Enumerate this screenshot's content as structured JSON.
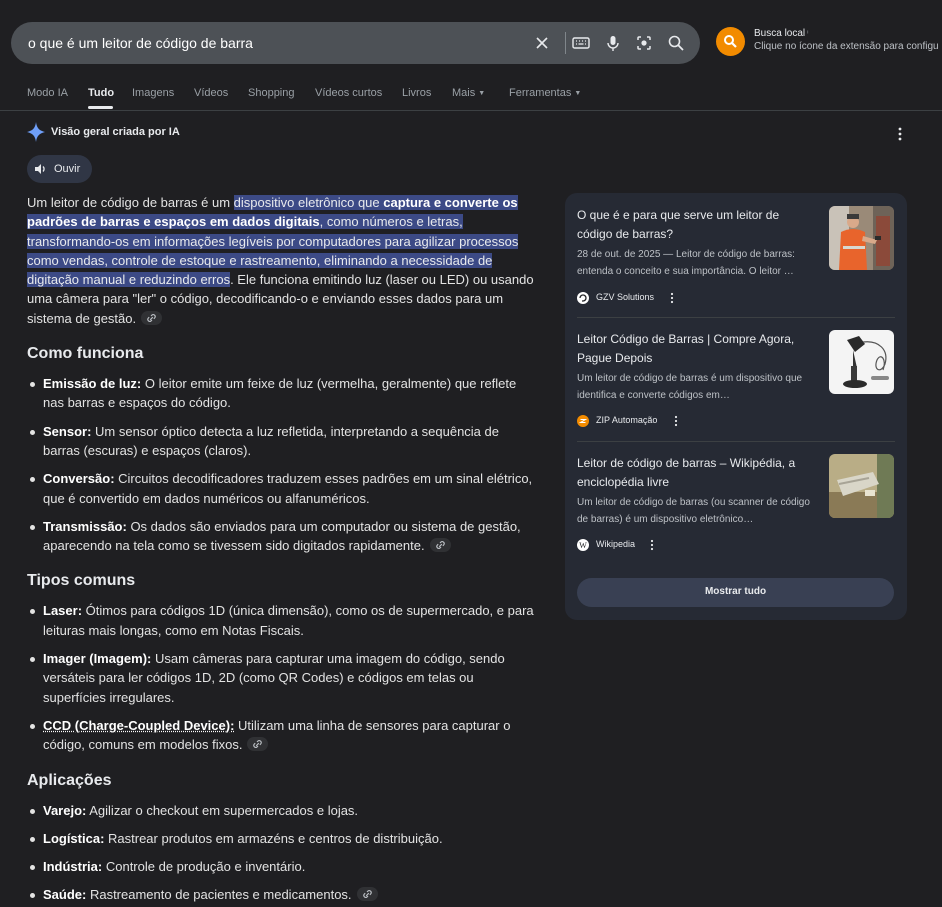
{
  "search": {
    "query": "o que é um leitor de código de barra"
  },
  "extension": {
    "title": "Busca local",
    "info": "ⁱ",
    "subtitle": "Clique no ícone da extensão para configu"
  },
  "tabs": [
    {
      "label": "Modo IA"
    },
    {
      "label": "Tudo"
    },
    {
      "label": "Imagens"
    },
    {
      "label": "Vídeos"
    },
    {
      "label": "Shopping"
    },
    {
      "label": "Vídeos curtos"
    },
    {
      "label": "Livros"
    },
    {
      "label": "Mais"
    },
    {
      "label": "Ferramentas"
    }
  ],
  "ai_overview": {
    "title": "Visão geral criada por IA",
    "listen_label": "Ouvir",
    "intro": {
      "before": "Um leitor de código de barras é um ",
      "hl1": "dispositivo eletrônico que ",
      "hl1_bold": "captura e converte os padrões de barras e espaços em dados digitais",
      "hl2": ", como números e letras, transformando-os em informações legíveis por computadores para agilizar processos como vendas, controle de estoque e rastreamento, eliminando a necessidade de digitação manual e reduzindo erros",
      "after": ". Ele funciona emitindo luz (laser ou LED) ou usando uma câmera para \"ler\" o código, decodificando-o e enviando esses dados para um sistema de gestão."
    },
    "how_it_works": {
      "heading": "Como funciona",
      "items": [
        {
          "term": "Emissão de luz:",
          "text": " O leitor emite um feixe de luz (vermelha, geralmente) que reflete nas barras e espaços do código."
        },
        {
          "term": "Sensor:",
          "text": " Um sensor óptico detecta a luz refletida, interpretando a sequência de barras (escuras) e espaços (claros)."
        },
        {
          "term": "Conversão:",
          "text": " Circuitos decodificadores traduzem esses padrões em um sinal elétrico, que é convertido em dados numéricos ou alfanuméricos."
        },
        {
          "term": "Transmissão:",
          "text": " Os dados são enviados para um computador ou sistema de gestão, aparecendo na tela como se tivessem sido digitados rapidamente."
        }
      ]
    },
    "types": {
      "heading": "Tipos comuns",
      "items": [
        {
          "term": "Laser:",
          "text": " Ótimos para códigos 1D (única dimensão), como os de supermercado, e para leituras mais longas, como em Notas Fiscais."
        },
        {
          "term": "Imager (Imagem):",
          "text": " Usam câmeras para capturar uma imagem do código, sendo versáteis para ler códigos 1D, 2D (como QR Codes) e códigos em telas ou superfícies irregulares."
        },
        {
          "term": "CCD (Charge-Coupled Device):",
          "text": " Utilizam uma linha de sensores para capturar o código, comuns em modelos fixos."
        }
      ]
    },
    "applications": {
      "heading": "Aplicações",
      "items": [
        {
          "term": "Varejo:",
          "text": " Agilizar o checkout em supermercados e lojas."
        },
        {
          "term": "Logística:",
          "text": " Rastrear produtos em armazéns e centros de distribuição."
        },
        {
          "term": "Indústria:",
          "text": " Controle de produção e inventário."
        },
        {
          "term": "Saúde:",
          "text": " Rastreamento de pacientes e medicamentos."
        }
      ]
    }
  },
  "sources": [
    {
      "title": "O que é e para que serve um leitor de código de barras?",
      "snippet": "28 de out. de 2025 — Leitor de código de barras: entenda o conceito e sua importância. O leitor …",
      "site": "GZV Solutions",
      "favicon_color": "#ffffff"
    },
    {
      "title": "Leitor Código de Barras | Compre Agora, Pague Depois",
      "snippet": "Um leitor de código de barras é um dispositivo que identifica e converte códigos em…",
      "site": "ZIP Automação",
      "favicon_color": "#f28b00"
    },
    {
      "title": "Leitor de código de barras – Wikipédia, a enciclopédia livre",
      "snippet": "Um leitor de código de barras (ou scanner de código de barras) é um dispositivo eletrônico…",
      "site": "Wikipedia",
      "favicon_color": "#ffffff"
    }
  ],
  "show_all_label": "Mostrar tudo",
  "colors": {
    "background": "#1f1f22",
    "search_bar": "#4d5156",
    "highlight": "#3c4a86",
    "extension_accent": "#f28b00",
    "sources_panel": "#262a34"
  }
}
